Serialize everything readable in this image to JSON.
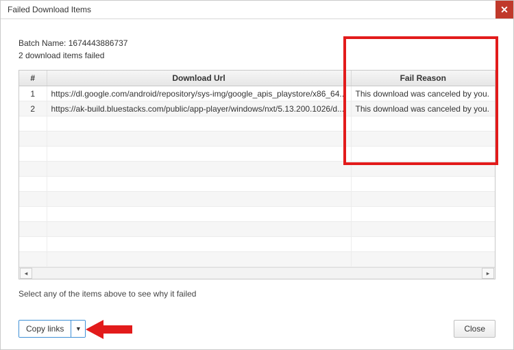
{
  "window": {
    "title": "Failed Download Items"
  },
  "meta": {
    "batch_label": "Batch Name:",
    "batch_name": "1674443886737",
    "fail_summary": "2 download items failed"
  },
  "table": {
    "headers": {
      "index": "#",
      "url": "Download Url",
      "reason": "Fail Reason"
    },
    "rows": [
      {
        "index": "1",
        "url": "https://dl.google.com/android/repository/sys-img/google_apis_playstore/x86_64...",
        "reason": "This download was canceled by you."
      },
      {
        "index": "2",
        "url": "https://ak-build.bluestacks.com/public/app-player/windows/nxt/5.13.200.1026/d...",
        "reason": "This download was canceled by you."
      }
    ]
  },
  "hint": "Select any of the items above to see why it failed",
  "buttons": {
    "copy_links": "Copy links",
    "close": "Close"
  }
}
